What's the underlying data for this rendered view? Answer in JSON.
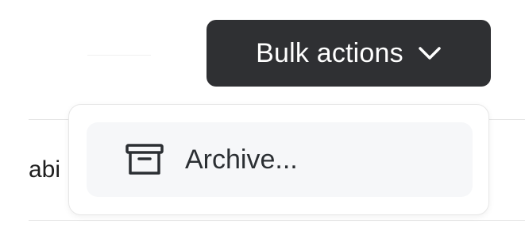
{
  "background": {
    "table_cell_fragment": "abi"
  },
  "bulk_actions": {
    "label": "Bulk actions",
    "icon": "chevron-down-icon"
  },
  "dropdown": {
    "items": [
      {
        "label": "Archive...",
        "icon": "archive-icon"
      }
    ]
  }
}
